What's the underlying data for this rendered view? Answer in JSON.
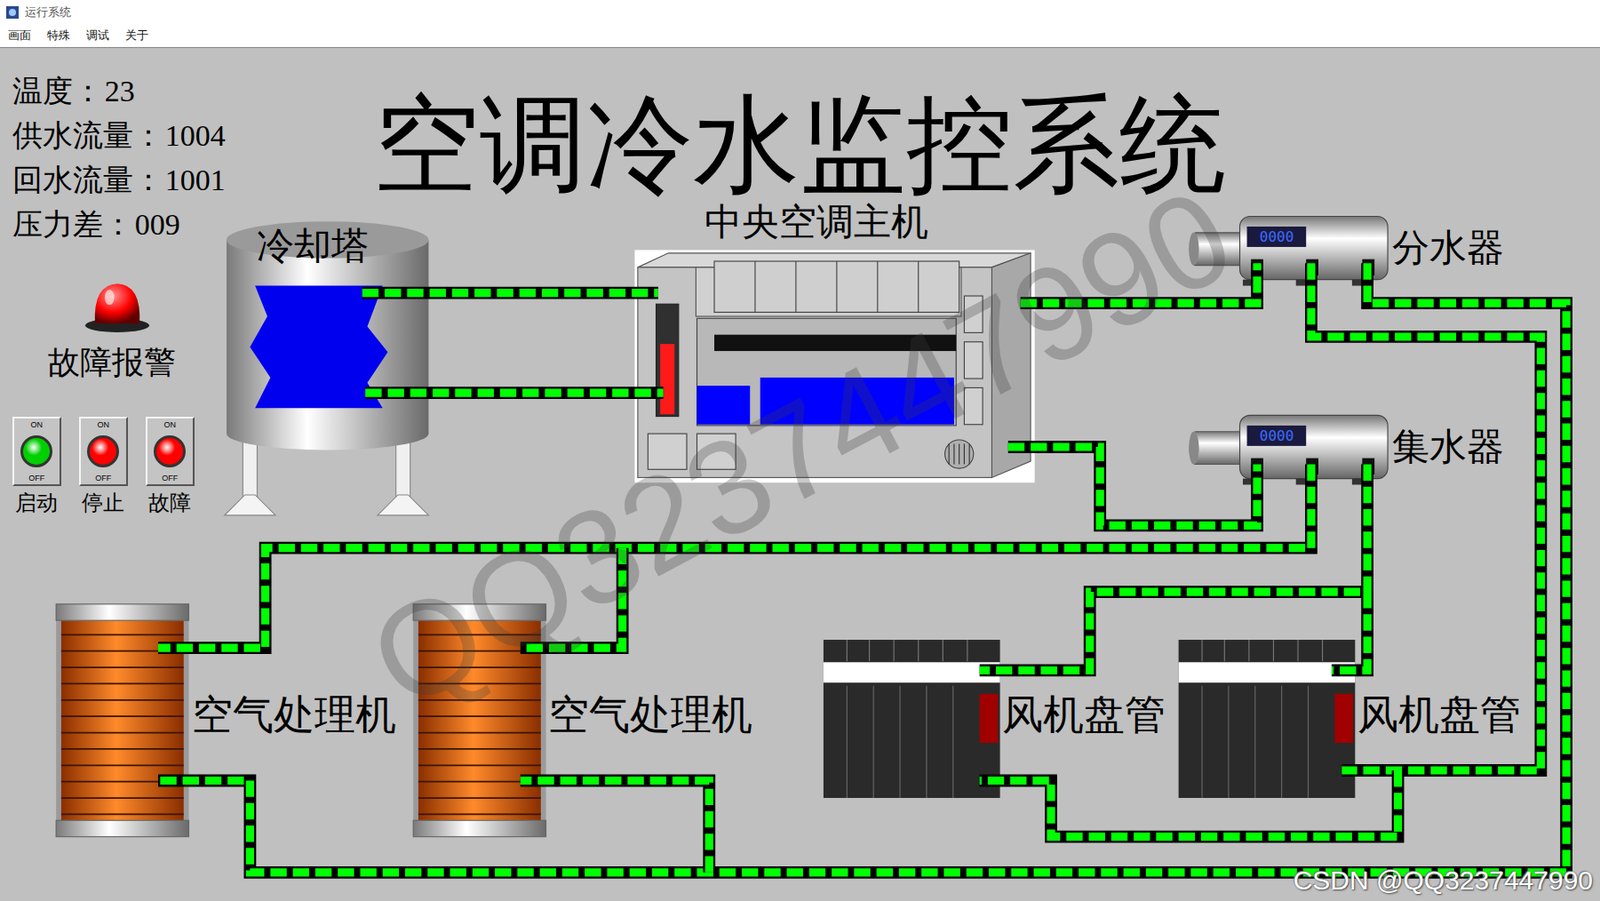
{
  "window": {
    "title": "运行系统"
  },
  "menu": [
    "画面",
    "特殊",
    "调试",
    "关于"
  ],
  "title": "空调冷水监控系统",
  "readings": [
    {
      "label": "温度：",
      "value": "23"
    },
    {
      "label": "供水流量：",
      "value": "1004"
    },
    {
      "label": "回水流量：",
      "value": "1001"
    },
    {
      "label": "压力差：",
      "value": "009"
    }
  ],
  "alarm": {
    "label": "故障报警",
    "active": true
  },
  "switches": [
    {
      "label": "启动",
      "on_text": "ON",
      "off_text": "OFF",
      "color": "#00d000"
    },
    {
      "label": "停止",
      "on_text": "ON",
      "off_text": "OFF",
      "color": "#ff0000"
    },
    {
      "label": "故障",
      "on_text": "ON",
      "off_text": "OFF",
      "color": "#ff0000"
    }
  ],
  "cooling_tower": {
    "label": "冷却塔"
  },
  "chiller": {
    "label": "中央空调主机",
    "level": 0.65
  },
  "headers": [
    {
      "label": "分水器",
      "display": "0000"
    },
    {
      "label": "集水器",
      "display": "0000"
    }
  ],
  "air_handlers": [
    {
      "label": "空气处理机"
    },
    {
      "label": "空气处理机"
    }
  ],
  "fan_coils": [
    {
      "label": "风机盘管"
    },
    {
      "label": "风机盘管"
    }
  ],
  "pipes": {
    "flowing": true
  },
  "watermark": "QQ3237447990",
  "footer": "CSDN @QQ3237447990"
}
